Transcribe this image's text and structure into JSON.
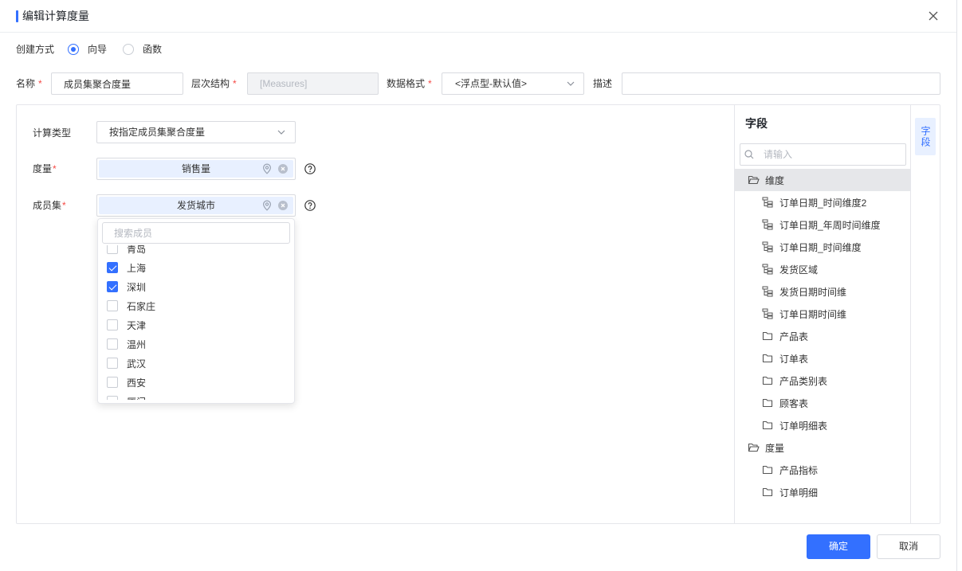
{
  "dialog": {
    "title": "编辑计算度量"
  },
  "create_mode": {
    "label": "创建方式",
    "options": [
      {
        "label": "向导",
        "selected": true
      },
      {
        "label": "函数",
        "selected": false
      }
    ]
  },
  "form": {
    "required_mark": "*",
    "name": {
      "label": "名称",
      "value": "成员集聚合度量"
    },
    "hierarchy": {
      "label": "层次结构",
      "value": "[Measures]",
      "disabled": true
    },
    "format": {
      "label": "数据格式",
      "value": "<浮点型-默认值>"
    },
    "description": {
      "label": "描述",
      "value": ""
    }
  },
  "calc": {
    "type": {
      "label": "计算类型",
      "value": "按指定成员集聚合度量"
    },
    "measure": {
      "label": "度量",
      "chip": "销售量"
    },
    "member_set": {
      "label": "成员集",
      "chip": "发货城市"
    }
  },
  "member_dropdown": {
    "search_placeholder": "搜索成员",
    "items": [
      {
        "label": "青岛",
        "checked": false
      },
      {
        "label": "上海",
        "checked": true
      },
      {
        "label": "深圳",
        "checked": true
      },
      {
        "label": "石家庄",
        "checked": false
      },
      {
        "label": "天津",
        "checked": false
      },
      {
        "label": "温州",
        "checked": false
      },
      {
        "label": "武汉",
        "checked": false
      },
      {
        "label": "西安",
        "checked": false
      },
      {
        "label": "厦门",
        "checked": false
      }
    ]
  },
  "field_panel": {
    "title": "字段",
    "search_placeholder": "请输入",
    "tree": [
      {
        "label": "维度",
        "icon": "folder-open-icon",
        "selected": true,
        "children": [
          {
            "label": "订单日期_时间维度2",
            "icon": "hierarchy-icon"
          },
          {
            "label": "订单日期_年周时间维度",
            "icon": "hierarchy-icon"
          },
          {
            "label": "订单日期_时间维度",
            "icon": "hierarchy-icon"
          },
          {
            "label": "发货区域",
            "icon": "hierarchy-icon"
          },
          {
            "label": "发货日期时间维",
            "icon": "hierarchy-icon"
          },
          {
            "label": "订单日期时间维",
            "icon": "hierarchy-icon"
          },
          {
            "label": "产品表",
            "icon": "folder-icon"
          },
          {
            "label": "订单表",
            "icon": "folder-icon"
          },
          {
            "label": "产品类别表",
            "icon": "folder-icon"
          },
          {
            "label": "顾客表",
            "icon": "folder-icon"
          },
          {
            "label": "订单明细表",
            "icon": "folder-icon"
          }
        ]
      },
      {
        "label": "度量",
        "icon": "folder-open-icon",
        "selected": false,
        "children": [
          {
            "label": "产品指标",
            "icon": "folder-icon"
          },
          {
            "label": "订单明细",
            "icon": "folder-icon"
          }
        ]
      }
    ]
  },
  "side_tab": {
    "label": "字段",
    "active": true
  },
  "footer": {
    "confirm": "确定",
    "cancel": "取消"
  },
  "colors": {
    "accent": "#3370ff",
    "required_mark": "#f54a45",
    "chip_background": "#e8f0ff",
    "selected_row_background": "#e6e7ea",
    "side_tab_background": "#e8f0ff"
  }
}
